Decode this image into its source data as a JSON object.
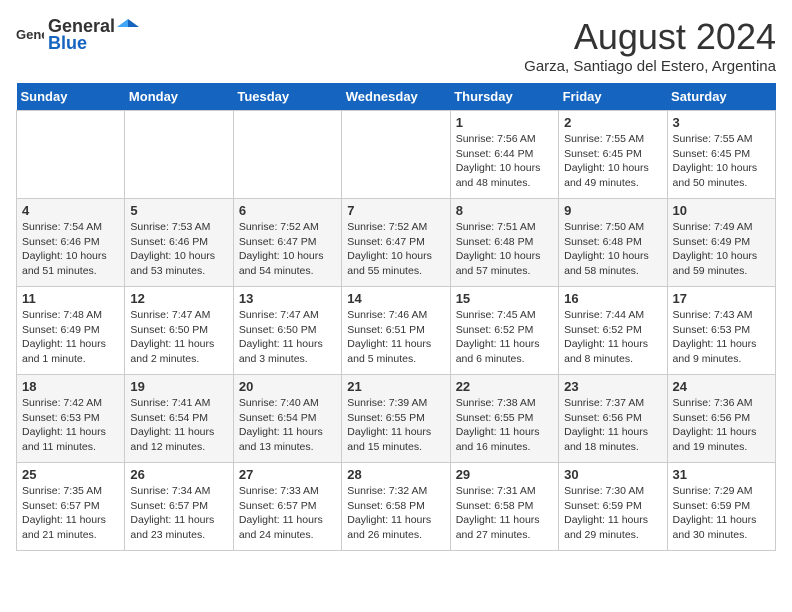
{
  "header": {
    "logo_general": "General",
    "logo_blue": "Blue",
    "title": "August 2024",
    "subtitle": "Garza, Santiago del Estero, Argentina"
  },
  "days_of_week": [
    "Sunday",
    "Monday",
    "Tuesday",
    "Wednesday",
    "Thursday",
    "Friday",
    "Saturday"
  ],
  "weeks": [
    [
      {
        "date": "",
        "info": ""
      },
      {
        "date": "",
        "info": ""
      },
      {
        "date": "",
        "info": ""
      },
      {
        "date": "",
        "info": ""
      },
      {
        "date": "1",
        "info": "Sunrise: 7:56 AM\nSunset: 6:44 PM\nDaylight: 10 hours and 48 minutes."
      },
      {
        "date": "2",
        "info": "Sunrise: 7:55 AM\nSunset: 6:45 PM\nDaylight: 10 hours and 49 minutes."
      },
      {
        "date": "3",
        "info": "Sunrise: 7:55 AM\nSunset: 6:45 PM\nDaylight: 10 hours and 50 minutes."
      }
    ],
    [
      {
        "date": "4",
        "info": "Sunrise: 7:54 AM\nSunset: 6:46 PM\nDaylight: 10 hours and 51 minutes."
      },
      {
        "date": "5",
        "info": "Sunrise: 7:53 AM\nSunset: 6:46 PM\nDaylight: 10 hours and 53 minutes."
      },
      {
        "date": "6",
        "info": "Sunrise: 7:52 AM\nSunset: 6:47 PM\nDaylight: 10 hours and 54 minutes."
      },
      {
        "date": "7",
        "info": "Sunrise: 7:52 AM\nSunset: 6:47 PM\nDaylight: 10 hours and 55 minutes."
      },
      {
        "date": "8",
        "info": "Sunrise: 7:51 AM\nSunset: 6:48 PM\nDaylight: 10 hours and 57 minutes."
      },
      {
        "date": "9",
        "info": "Sunrise: 7:50 AM\nSunset: 6:48 PM\nDaylight: 10 hours and 58 minutes."
      },
      {
        "date": "10",
        "info": "Sunrise: 7:49 AM\nSunset: 6:49 PM\nDaylight: 10 hours and 59 minutes."
      }
    ],
    [
      {
        "date": "11",
        "info": "Sunrise: 7:48 AM\nSunset: 6:49 PM\nDaylight: 11 hours and 1 minute."
      },
      {
        "date": "12",
        "info": "Sunrise: 7:47 AM\nSunset: 6:50 PM\nDaylight: 11 hours and 2 minutes."
      },
      {
        "date": "13",
        "info": "Sunrise: 7:47 AM\nSunset: 6:50 PM\nDaylight: 11 hours and 3 minutes."
      },
      {
        "date": "14",
        "info": "Sunrise: 7:46 AM\nSunset: 6:51 PM\nDaylight: 11 hours and 5 minutes."
      },
      {
        "date": "15",
        "info": "Sunrise: 7:45 AM\nSunset: 6:52 PM\nDaylight: 11 hours and 6 minutes."
      },
      {
        "date": "16",
        "info": "Sunrise: 7:44 AM\nSunset: 6:52 PM\nDaylight: 11 hours and 8 minutes."
      },
      {
        "date": "17",
        "info": "Sunrise: 7:43 AM\nSunset: 6:53 PM\nDaylight: 11 hours and 9 minutes."
      }
    ],
    [
      {
        "date": "18",
        "info": "Sunrise: 7:42 AM\nSunset: 6:53 PM\nDaylight: 11 hours and 11 minutes."
      },
      {
        "date": "19",
        "info": "Sunrise: 7:41 AM\nSunset: 6:54 PM\nDaylight: 11 hours and 12 minutes."
      },
      {
        "date": "20",
        "info": "Sunrise: 7:40 AM\nSunset: 6:54 PM\nDaylight: 11 hours and 13 minutes."
      },
      {
        "date": "21",
        "info": "Sunrise: 7:39 AM\nSunset: 6:55 PM\nDaylight: 11 hours and 15 minutes."
      },
      {
        "date": "22",
        "info": "Sunrise: 7:38 AM\nSunset: 6:55 PM\nDaylight: 11 hours and 16 minutes."
      },
      {
        "date": "23",
        "info": "Sunrise: 7:37 AM\nSunset: 6:56 PM\nDaylight: 11 hours and 18 minutes."
      },
      {
        "date": "24",
        "info": "Sunrise: 7:36 AM\nSunset: 6:56 PM\nDaylight: 11 hours and 19 minutes."
      }
    ],
    [
      {
        "date": "25",
        "info": "Sunrise: 7:35 AM\nSunset: 6:57 PM\nDaylight: 11 hours and 21 minutes."
      },
      {
        "date": "26",
        "info": "Sunrise: 7:34 AM\nSunset: 6:57 PM\nDaylight: 11 hours and 23 minutes."
      },
      {
        "date": "27",
        "info": "Sunrise: 7:33 AM\nSunset: 6:57 PM\nDaylight: 11 hours and 24 minutes."
      },
      {
        "date": "28",
        "info": "Sunrise: 7:32 AM\nSunset: 6:58 PM\nDaylight: 11 hours and 26 minutes."
      },
      {
        "date": "29",
        "info": "Sunrise: 7:31 AM\nSunset: 6:58 PM\nDaylight: 11 hours and 27 minutes."
      },
      {
        "date": "30",
        "info": "Sunrise: 7:30 AM\nSunset: 6:59 PM\nDaylight: 11 hours and 29 minutes."
      },
      {
        "date": "31",
        "info": "Sunrise: 7:29 AM\nSunset: 6:59 PM\nDaylight: 11 hours and 30 minutes."
      }
    ]
  ]
}
